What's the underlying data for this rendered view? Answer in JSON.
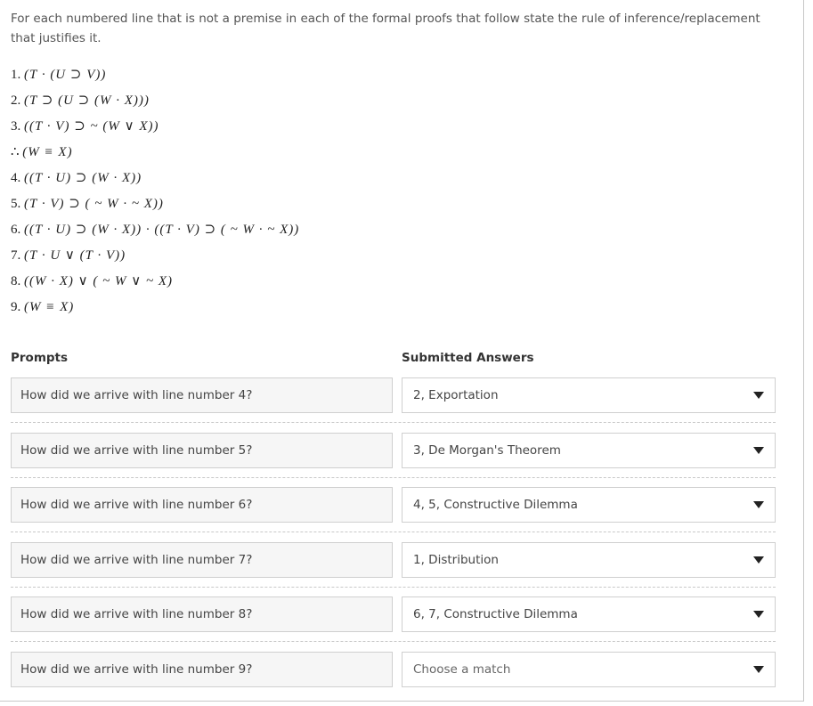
{
  "instructions": "For each numbered line that is not a premise in each of the formal proofs that follow state the rule of inference/replacement that justifies it.",
  "proof": [
    {
      "num": "1.",
      "formula": "(T · (U ⊃ V))"
    },
    {
      "num": "2.",
      "formula": "(T ⊃ (U ⊃ (W · X)))"
    },
    {
      "num": "3.",
      "formula": "((T · V) ⊃ ~ (W ∨ X))"
    },
    {
      "num": "∴",
      "formula": "(W ≡ X)"
    },
    {
      "num": "4.",
      "formula": "((T · U) ⊃ (W · X))"
    },
    {
      "num": "5.",
      "formula": "(T · V) ⊃ ( ~ W · ~ X))"
    },
    {
      "num": "6.",
      "formula": "((T · U) ⊃ (W · X)) · ((T · V) ⊃ ( ~ W · ~ X))"
    },
    {
      "num": "7.",
      "formula": "(T · U ∨ (T · V))"
    },
    {
      "num": "8.",
      "formula": "((W · X) ∨ ( ~ W ∨ ~ X)"
    },
    {
      "num": "9.",
      "formula": "(W ≡ X)"
    }
  ],
  "headers": {
    "prompts": "Prompts",
    "answers": "Submitted Answers"
  },
  "rows": [
    {
      "prompt": "How did we arrive with line number 4?",
      "answer": "2, Exportation",
      "placeholder": false
    },
    {
      "prompt": "How did we arrive with line number 5?",
      "answer": "3, De Morgan's Theorem",
      "placeholder": false
    },
    {
      "prompt": "How did we arrive with line number 6?",
      "answer": "4, 5, Constructive Dilemma",
      "placeholder": false
    },
    {
      "prompt": "How did we arrive with line number 7?",
      "answer": "1, Distribution",
      "placeholder": false
    },
    {
      "prompt": "How did we arrive with line number 8?",
      "answer": "6, 7, Constructive Dilemma",
      "placeholder": false
    },
    {
      "prompt": "How did we arrive with line number 9?",
      "answer": "Choose a match",
      "placeholder": true
    }
  ]
}
